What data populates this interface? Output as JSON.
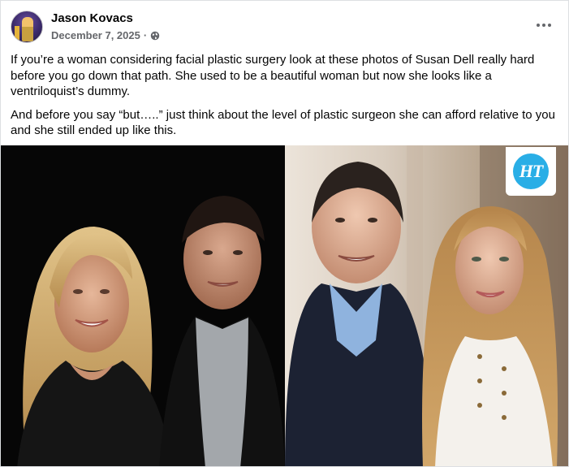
{
  "post": {
    "author": "Jason Kovacs",
    "date": "December 7, 2025",
    "separator": "·",
    "audience_icon": "globe-icon",
    "more_icon": "more-options-icon",
    "paragraphs": [
      "If you’re a woman considering facial plastic surgery look at these photos of Susan Dell really hard before you go down that path.  She used to be a beautiful woman but now she looks like a ventriloquist’s dummy.",
      "And before you say “but…..” just think about the level of plastic surgeon she can afford relative to you and she still ended up like this."
    ],
    "photos": {
      "right_watermark": "HT"
    }
  },
  "colors": {
    "name_text": "#050505",
    "meta_text": "#65676b",
    "ht_blue": "#29aee6"
  }
}
